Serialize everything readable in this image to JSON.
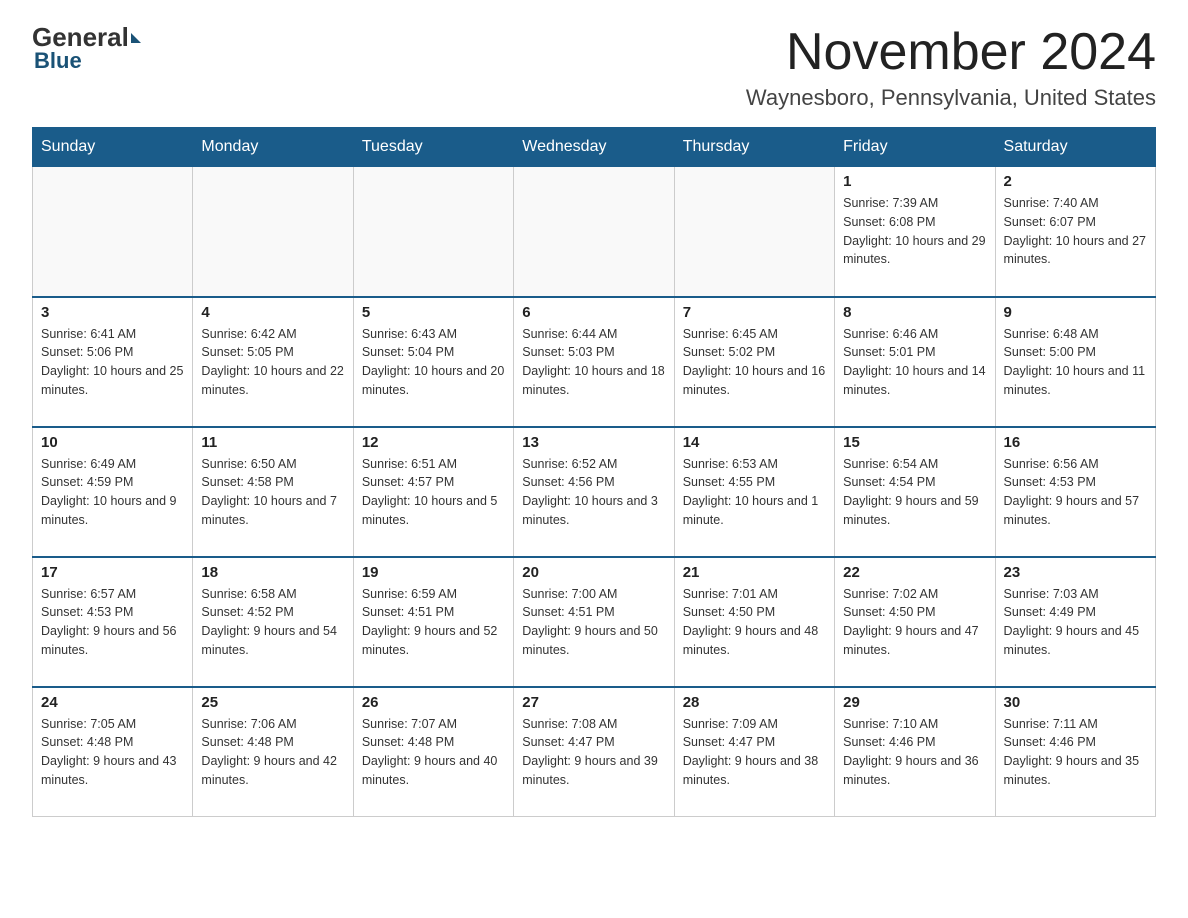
{
  "header": {
    "logo_general": "General",
    "logo_blue": "Blue",
    "month": "November 2024",
    "location": "Waynesboro, Pennsylvania, United States"
  },
  "days_of_week": [
    "Sunday",
    "Monday",
    "Tuesday",
    "Wednesday",
    "Thursday",
    "Friday",
    "Saturday"
  ],
  "weeks": [
    [
      {
        "day": "",
        "info": ""
      },
      {
        "day": "",
        "info": ""
      },
      {
        "day": "",
        "info": ""
      },
      {
        "day": "",
        "info": ""
      },
      {
        "day": "",
        "info": ""
      },
      {
        "day": "1",
        "info": "Sunrise: 7:39 AM\nSunset: 6:08 PM\nDaylight: 10 hours and 29 minutes."
      },
      {
        "day": "2",
        "info": "Sunrise: 7:40 AM\nSunset: 6:07 PM\nDaylight: 10 hours and 27 minutes."
      }
    ],
    [
      {
        "day": "3",
        "info": "Sunrise: 6:41 AM\nSunset: 5:06 PM\nDaylight: 10 hours and 25 minutes."
      },
      {
        "day": "4",
        "info": "Sunrise: 6:42 AM\nSunset: 5:05 PM\nDaylight: 10 hours and 22 minutes."
      },
      {
        "day": "5",
        "info": "Sunrise: 6:43 AM\nSunset: 5:04 PM\nDaylight: 10 hours and 20 minutes."
      },
      {
        "day": "6",
        "info": "Sunrise: 6:44 AM\nSunset: 5:03 PM\nDaylight: 10 hours and 18 minutes."
      },
      {
        "day": "7",
        "info": "Sunrise: 6:45 AM\nSunset: 5:02 PM\nDaylight: 10 hours and 16 minutes."
      },
      {
        "day": "8",
        "info": "Sunrise: 6:46 AM\nSunset: 5:01 PM\nDaylight: 10 hours and 14 minutes."
      },
      {
        "day": "9",
        "info": "Sunrise: 6:48 AM\nSunset: 5:00 PM\nDaylight: 10 hours and 11 minutes."
      }
    ],
    [
      {
        "day": "10",
        "info": "Sunrise: 6:49 AM\nSunset: 4:59 PM\nDaylight: 10 hours and 9 minutes."
      },
      {
        "day": "11",
        "info": "Sunrise: 6:50 AM\nSunset: 4:58 PM\nDaylight: 10 hours and 7 minutes."
      },
      {
        "day": "12",
        "info": "Sunrise: 6:51 AM\nSunset: 4:57 PM\nDaylight: 10 hours and 5 minutes."
      },
      {
        "day": "13",
        "info": "Sunrise: 6:52 AM\nSunset: 4:56 PM\nDaylight: 10 hours and 3 minutes."
      },
      {
        "day": "14",
        "info": "Sunrise: 6:53 AM\nSunset: 4:55 PM\nDaylight: 10 hours and 1 minute."
      },
      {
        "day": "15",
        "info": "Sunrise: 6:54 AM\nSunset: 4:54 PM\nDaylight: 9 hours and 59 minutes."
      },
      {
        "day": "16",
        "info": "Sunrise: 6:56 AM\nSunset: 4:53 PM\nDaylight: 9 hours and 57 minutes."
      }
    ],
    [
      {
        "day": "17",
        "info": "Sunrise: 6:57 AM\nSunset: 4:53 PM\nDaylight: 9 hours and 56 minutes."
      },
      {
        "day": "18",
        "info": "Sunrise: 6:58 AM\nSunset: 4:52 PM\nDaylight: 9 hours and 54 minutes."
      },
      {
        "day": "19",
        "info": "Sunrise: 6:59 AM\nSunset: 4:51 PM\nDaylight: 9 hours and 52 minutes."
      },
      {
        "day": "20",
        "info": "Sunrise: 7:00 AM\nSunset: 4:51 PM\nDaylight: 9 hours and 50 minutes."
      },
      {
        "day": "21",
        "info": "Sunrise: 7:01 AM\nSunset: 4:50 PM\nDaylight: 9 hours and 48 minutes."
      },
      {
        "day": "22",
        "info": "Sunrise: 7:02 AM\nSunset: 4:50 PM\nDaylight: 9 hours and 47 minutes."
      },
      {
        "day": "23",
        "info": "Sunrise: 7:03 AM\nSunset: 4:49 PM\nDaylight: 9 hours and 45 minutes."
      }
    ],
    [
      {
        "day": "24",
        "info": "Sunrise: 7:05 AM\nSunset: 4:48 PM\nDaylight: 9 hours and 43 minutes."
      },
      {
        "day": "25",
        "info": "Sunrise: 7:06 AM\nSunset: 4:48 PM\nDaylight: 9 hours and 42 minutes."
      },
      {
        "day": "26",
        "info": "Sunrise: 7:07 AM\nSunset: 4:48 PM\nDaylight: 9 hours and 40 minutes."
      },
      {
        "day": "27",
        "info": "Sunrise: 7:08 AM\nSunset: 4:47 PM\nDaylight: 9 hours and 39 minutes."
      },
      {
        "day": "28",
        "info": "Sunrise: 7:09 AM\nSunset: 4:47 PM\nDaylight: 9 hours and 38 minutes."
      },
      {
        "day": "29",
        "info": "Sunrise: 7:10 AM\nSunset: 4:46 PM\nDaylight: 9 hours and 36 minutes."
      },
      {
        "day": "30",
        "info": "Sunrise: 7:11 AM\nSunset: 4:46 PM\nDaylight: 9 hours and 35 minutes."
      }
    ]
  ]
}
